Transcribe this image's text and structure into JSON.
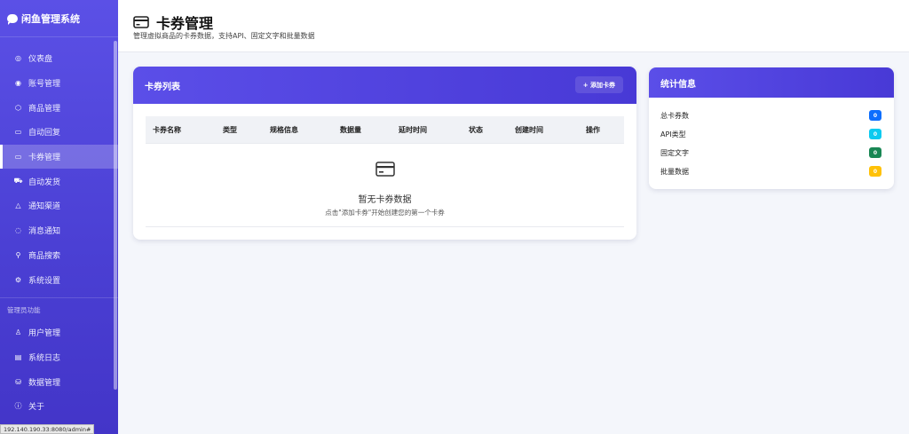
{
  "brand": {
    "name": "闲鱼管理系统",
    "icon": "chat-bubble-icon"
  },
  "sidebar": {
    "items": [
      {
        "label": "仪表盘",
        "icon": "dashboard-icon",
        "glyph": "◎"
      },
      {
        "label": "账号管理",
        "icon": "user-circle-icon",
        "glyph": "◉"
      },
      {
        "label": "商品管理",
        "icon": "box-icon",
        "glyph": "⬡"
      },
      {
        "label": "自动回复",
        "icon": "chat-icon",
        "glyph": "▭"
      },
      {
        "label": "卡券管理",
        "icon": "card-icon",
        "glyph": "▭",
        "active": true
      },
      {
        "label": "自动发货",
        "icon": "truck-icon",
        "glyph": "⛟"
      },
      {
        "label": "通知渠道",
        "icon": "bell-icon",
        "glyph": "△"
      },
      {
        "label": "消息通知",
        "icon": "message-icon",
        "glyph": "◌"
      },
      {
        "label": "商品搜索",
        "icon": "search-icon",
        "glyph": "⚲"
      },
      {
        "label": "系统设置",
        "icon": "gear-icon",
        "glyph": "⚙"
      }
    ],
    "admin_label": "管理员功能",
    "admin_items": [
      {
        "label": "用户管理",
        "icon": "users-icon",
        "glyph": "♙"
      },
      {
        "label": "系统日志",
        "icon": "log-icon",
        "glyph": "▤"
      },
      {
        "label": "数据管理",
        "icon": "database-icon",
        "glyph": "⛁"
      },
      {
        "label": "关于",
        "icon": "info-icon",
        "glyph": "ⓘ"
      }
    ]
  },
  "header": {
    "title": "卡券管理",
    "subtitle": "管理虚拟商品的卡券数据，支持API、固定文字和批量数据"
  },
  "list": {
    "title": "卡券列表",
    "add_button": "+ 添加卡券",
    "columns": [
      "卡券名称",
      "类型",
      "规格信息",
      "数据量",
      "延时时间",
      "状态",
      "创建时间",
      "操作"
    ],
    "empty_title": "暂无卡券数据",
    "empty_hint": "点击\"添加卡券\"开始创建您的第一个卡券"
  },
  "stats": {
    "title": "统计信息",
    "rows": [
      {
        "label": "总卡券数",
        "value": "0",
        "color": "#0d6efd"
      },
      {
        "label": "API类型",
        "value": "0",
        "color": "#0dcaf0"
      },
      {
        "label": "固定文字",
        "value": "0",
        "color": "#198754"
      },
      {
        "label": "批量数据",
        "value": "0",
        "color": "#ffc107"
      }
    ]
  },
  "status_url": "192.140.190.33:8080/admin#"
}
